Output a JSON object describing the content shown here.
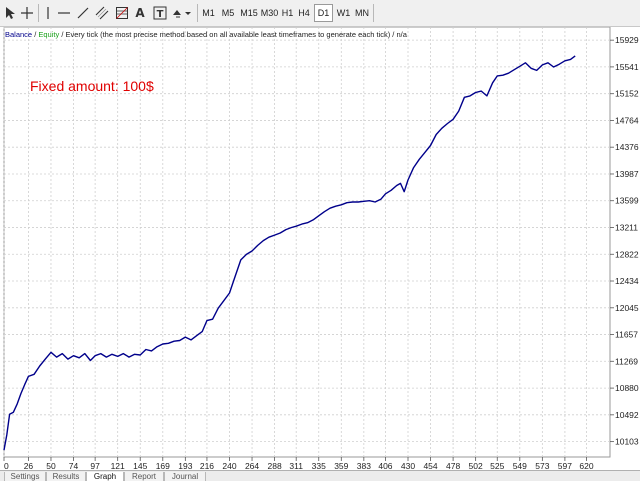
{
  "toolbar": {
    "tools": [
      {
        "name": "cursor-arrow-icon"
      },
      {
        "name": "crosshair-icon"
      },
      {
        "name": "vertical-line-icon"
      },
      {
        "name": "horizontal-line-icon"
      },
      {
        "name": "trendline-icon"
      },
      {
        "name": "channel-icon"
      },
      {
        "name": "fibonacci-icon"
      },
      {
        "name": "text-icon",
        "label": "A"
      },
      {
        "name": "text-label-icon",
        "label": "T"
      },
      {
        "name": "arrows-icon"
      }
    ],
    "timeframes": [
      "M1",
      "M5",
      "M15",
      "M30",
      "H1",
      "H4",
      "D1",
      "W1",
      "MN"
    ],
    "active_timeframe": "D1"
  },
  "legend": {
    "balance": "Balance",
    "slash": " / ",
    "equity": "Equity",
    "rest": " / Every tick (the most precise method based on all available least timeframes to generate each tick) / n/a"
  },
  "annotation": "Fixed amount: 100$",
  "colors": {
    "balance": "#00008b",
    "equity": "#1aa01a",
    "annotation": "#e00000",
    "grid": "#cfcfcf"
  },
  "chart_data": {
    "type": "line",
    "series": [
      {
        "name": "Balance"
      },
      {
        "name": "Equity"
      }
    ],
    "x_tick_labels": [
      "0",
      "26",
      "50",
      "74",
      "97",
      "121",
      "145",
      "169",
      "193",
      "216",
      "240",
      "264",
      "288",
      "311",
      "335",
      "359",
      "383",
      "406",
      "430",
      "454",
      "478",
      "502",
      "525",
      "549",
      "573",
      "597",
      "620"
    ],
    "y_tick_labels": [
      "10103",
      "10492",
      "10880",
      "11269",
      "11657",
      "12045",
      "12434",
      "12822",
      "13211",
      "13599",
      "13987",
      "14376",
      "14764",
      "15152",
      "15541",
      "15929"
    ],
    "xlim": [
      0,
      645
    ],
    "ylim": [
      9880,
      16120
    ],
    "points": [
      [
        0,
        9980
      ],
      [
        3,
        10200
      ],
      [
        6,
        10500
      ],
      [
        10,
        10530
      ],
      [
        14,
        10650
      ],
      [
        18,
        10800
      ],
      [
        22,
        10930
      ],
      [
        26,
        11050
      ],
      [
        32,
        11080
      ],
      [
        38,
        11200
      ],
      [
        44,
        11300
      ],
      [
        50,
        11400
      ],
      [
        56,
        11330
      ],
      [
        62,
        11380
      ],
      [
        68,
        11300
      ],
      [
        74,
        11350
      ],
      [
        80,
        11320
      ],
      [
        86,
        11380
      ],
      [
        92,
        11280
      ],
      [
        97,
        11350
      ],
      [
        103,
        11380
      ],
      [
        109,
        11330
      ],
      [
        115,
        11370
      ],
      [
        121,
        11340
      ],
      [
        127,
        11380
      ],
      [
        133,
        11330
      ],
      [
        139,
        11370
      ],
      [
        145,
        11360
      ],
      [
        151,
        11440
      ],
      [
        157,
        11420
      ],
      [
        163,
        11480
      ],
      [
        169,
        11520
      ],
      [
        175,
        11530
      ],
      [
        181,
        11560
      ],
      [
        187,
        11570
      ],
      [
        193,
        11620
      ],
      [
        199,
        11580
      ],
      [
        205,
        11640
      ],
      [
        211,
        11700
      ],
      [
        216,
        11860
      ],
      [
        222,
        11880
      ],
      [
        228,
        12040
      ],
      [
        234,
        12150
      ],
      [
        240,
        12260
      ],
      [
        246,
        12500
      ],
      [
        252,
        12740
      ],
      [
        258,
        12820
      ],
      [
        264,
        12870
      ],
      [
        270,
        12950
      ],
      [
        276,
        13020
      ],
      [
        282,
        13070
      ],
      [
        288,
        13100
      ],
      [
        294,
        13130
      ],
      [
        300,
        13180
      ],
      [
        306,
        13210
      ],
      [
        311,
        13230
      ],
      [
        317,
        13260
      ],
      [
        323,
        13280
      ],
      [
        329,
        13320
      ],
      [
        335,
        13380
      ],
      [
        341,
        13440
      ],
      [
        347,
        13490
      ],
      [
        353,
        13520
      ],
      [
        359,
        13540
      ],
      [
        365,
        13570
      ],
      [
        371,
        13580
      ],
      [
        377,
        13580
      ],
      [
        383,
        13590
      ],
      [
        389,
        13600
      ],
      [
        395,
        13580
      ],
      [
        401,
        13620
      ],
      [
        406,
        13700
      ],
      [
        412,
        13750
      ],
      [
        418,
        13820
      ],
      [
        422,
        13850
      ],
      [
        426,
        13730
      ],
      [
        430,
        13900
      ],
      [
        436,
        14080
      ],
      [
        442,
        14200
      ],
      [
        448,
        14300
      ],
      [
        454,
        14400
      ],
      [
        460,
        14560
      ],
      [
        466,
        14650
      ],
      [
        472,
        14720
      ],
      [
        478,
        14780
      ],
      [
        484,
        14900
      ],
      [
        490,
        15100
      ],
      [
        496,
        15120
      ],
      [
        502,
        15170
      ],
      [
        508,
        15190
      ],
      [
        514,
        15120
      ],
      [
        520,
        15310
      ],
      [
        525,
        15410
      ],
      [
        531,
        15420
      ],
      [
        537,
        15450
      ],
      [
        543,
        15500
      ],
      [
        549,
        15550
      ],
      [
        555,
        15600
      ],
      [
        561,
        15520
      ],
      [
        567,
        15490
      ],
      [
        573,
        15570
      ],
      [
        579,
        15600
      ],
      [
        585,
        15540
      ],
      [
        591,
        15580
      ],
      [
        597,
        15630
      ],
      [
        603,
        15650
      ],
      [
        608,
        15700
      ]
    ]
  },
  "tabs": [
    "Settings",
    "Results",
    "Graph",
    "Report",
    "Journal"
  ],
  "active_tab": "Graph"
}
